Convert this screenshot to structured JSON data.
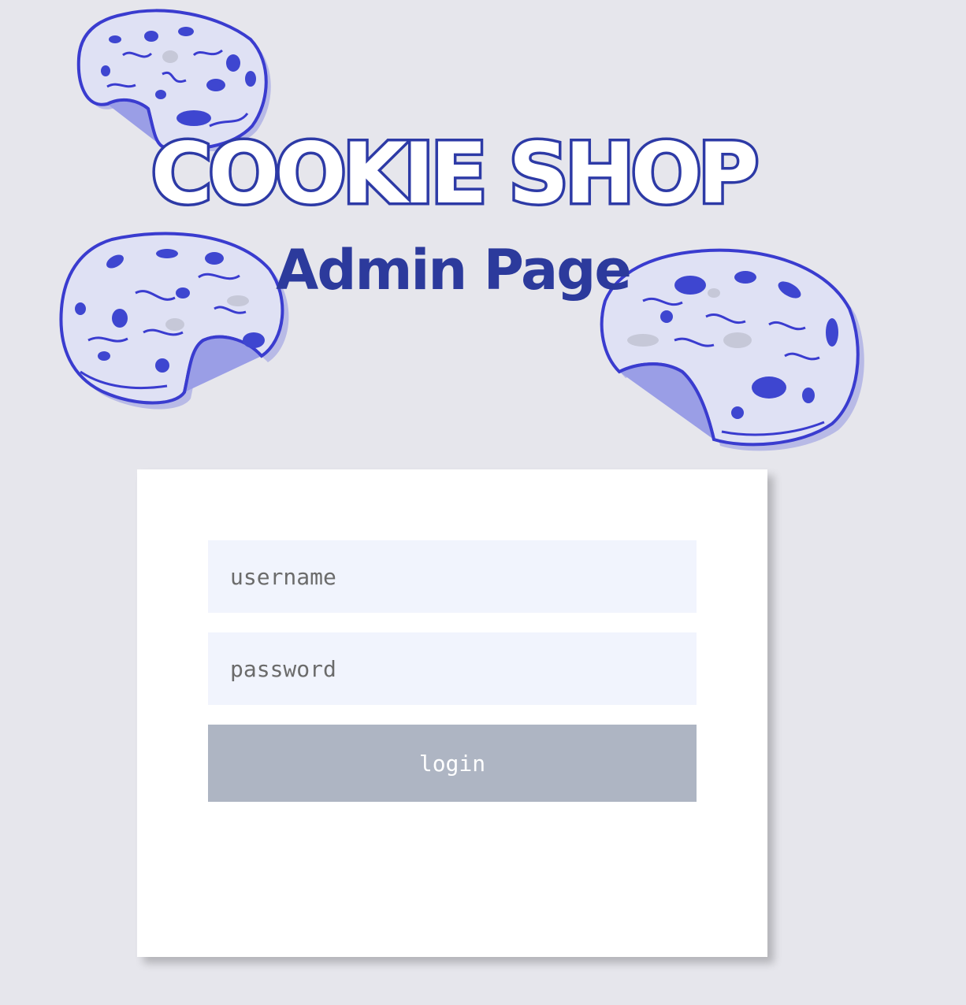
{
  "header": {
    "title": "COOKIE SHOP",
    "subtitle": "Admin Page"
  },
  "login_form": {
    "username_placeholder": "username",
    "password_placeholder": "password",
    "login_label": "login"
  },
  "decorations": {
    "cookie_icon": "bitten-cookie-icon"
  },
  "colors": {
    "background": "#e6e6ec",
    "brand_blue": "#2d3aa6",
    "input_background": "#f1f4fd",
    "button_background": "#aeb5c3"
  }
}
